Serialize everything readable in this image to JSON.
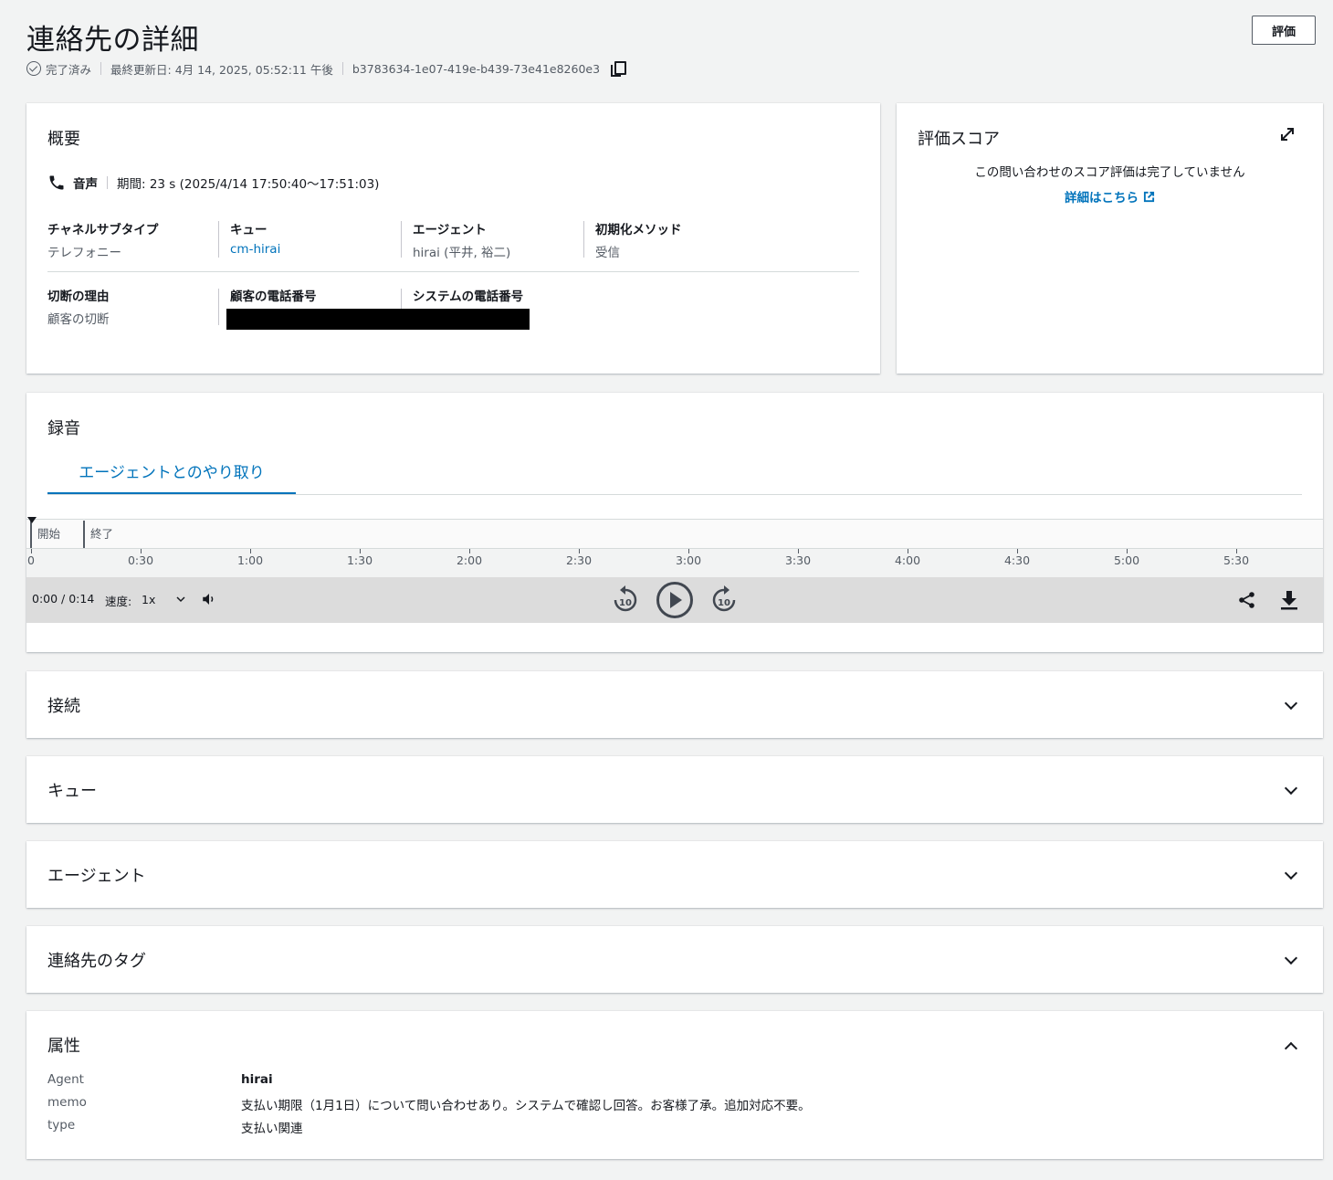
{
  "header": {
    "title": "連絡先の詳細",
    "status": "完了済み",
    "last_updated": "最終更新日: 4月 14, 2025, 05:52:11 午後",
    "contact_id": "b3783634-1e07-419e-b439-73e41e8260e3",
    "evaluate_button": "評価"
  },
  "summary": {
    "title": "概要",
    "channel": "音声",
    "duration": "期間: 23 s (2025/4/14 17:50:40〜17:51:03)",
    "fields_row1": [
      {
        "label": "チャネルサブタイプ",
        "value": "テレフォニー"
      },
      {
        "label": "キュー",
        "value": "cm-hirai"
      },
      {
        "label": "エージェント",
        "value": "hirai (平井, 裕二)"
      },
      {
        "label": "初期化メソッド",
        "value": "受信"
      }
    ],
    "fields_row2": [
      {
        "label": "切断の理由",
        "value": "顧客の切断"
      },
      {
        "label": "顧客の電話番号",
        "value": ""
      },
      {
        "label": "システムの電話番号",
        "value": ""
      }
    ]
  },
  "score": {
    "title": "評価スコア",
    "message": "この問い合わせのスコア評価は完了していません",
    "link": "詳細はこちら"
  },
  "recording": {
    "title": "録音",
    "tab": "エージェントとのやり取り",
    "markers": {
      "start": "開始",
      "end": "終了"
    },
    "ticks": [
      "0",
      "0:30",
      "1:00",
      "1:30",
      "2:00",
      "2:30",
      "3:00",
      "3:30",
      "4:00",
      "4:30",
      "5:00",
      "5:30"
    ],
    "time": "0:00 / 0:14",
    "speed_label": "速度:",
    "speed_value": "1x",
    "skip_seconds": "10"
  },
  "sections": {
    "connection": "接続",
    "queue": "キュー",
    "agent": "エージェント",
    "tags": "連絡先のタグ"
  },
  "attributes": {
    "title": "属性",
    "items": [
      {
        "key": "Agent",
        "value": "hirai"
      },
      {
        "key": "memo",
        "value": "支払い期限（1月1日）について問い合わせあり。システムで確認し回答。お客様了承。追加対応不要。"
      },
      {
        "key": "type",
        "value": "支払い関連"
      }
    ]
  },
  "colors": {
    "link": "#0073bb",
    "background": "#f2f3f3",
    "player_bar": "#dcdcdc"
  }
}
